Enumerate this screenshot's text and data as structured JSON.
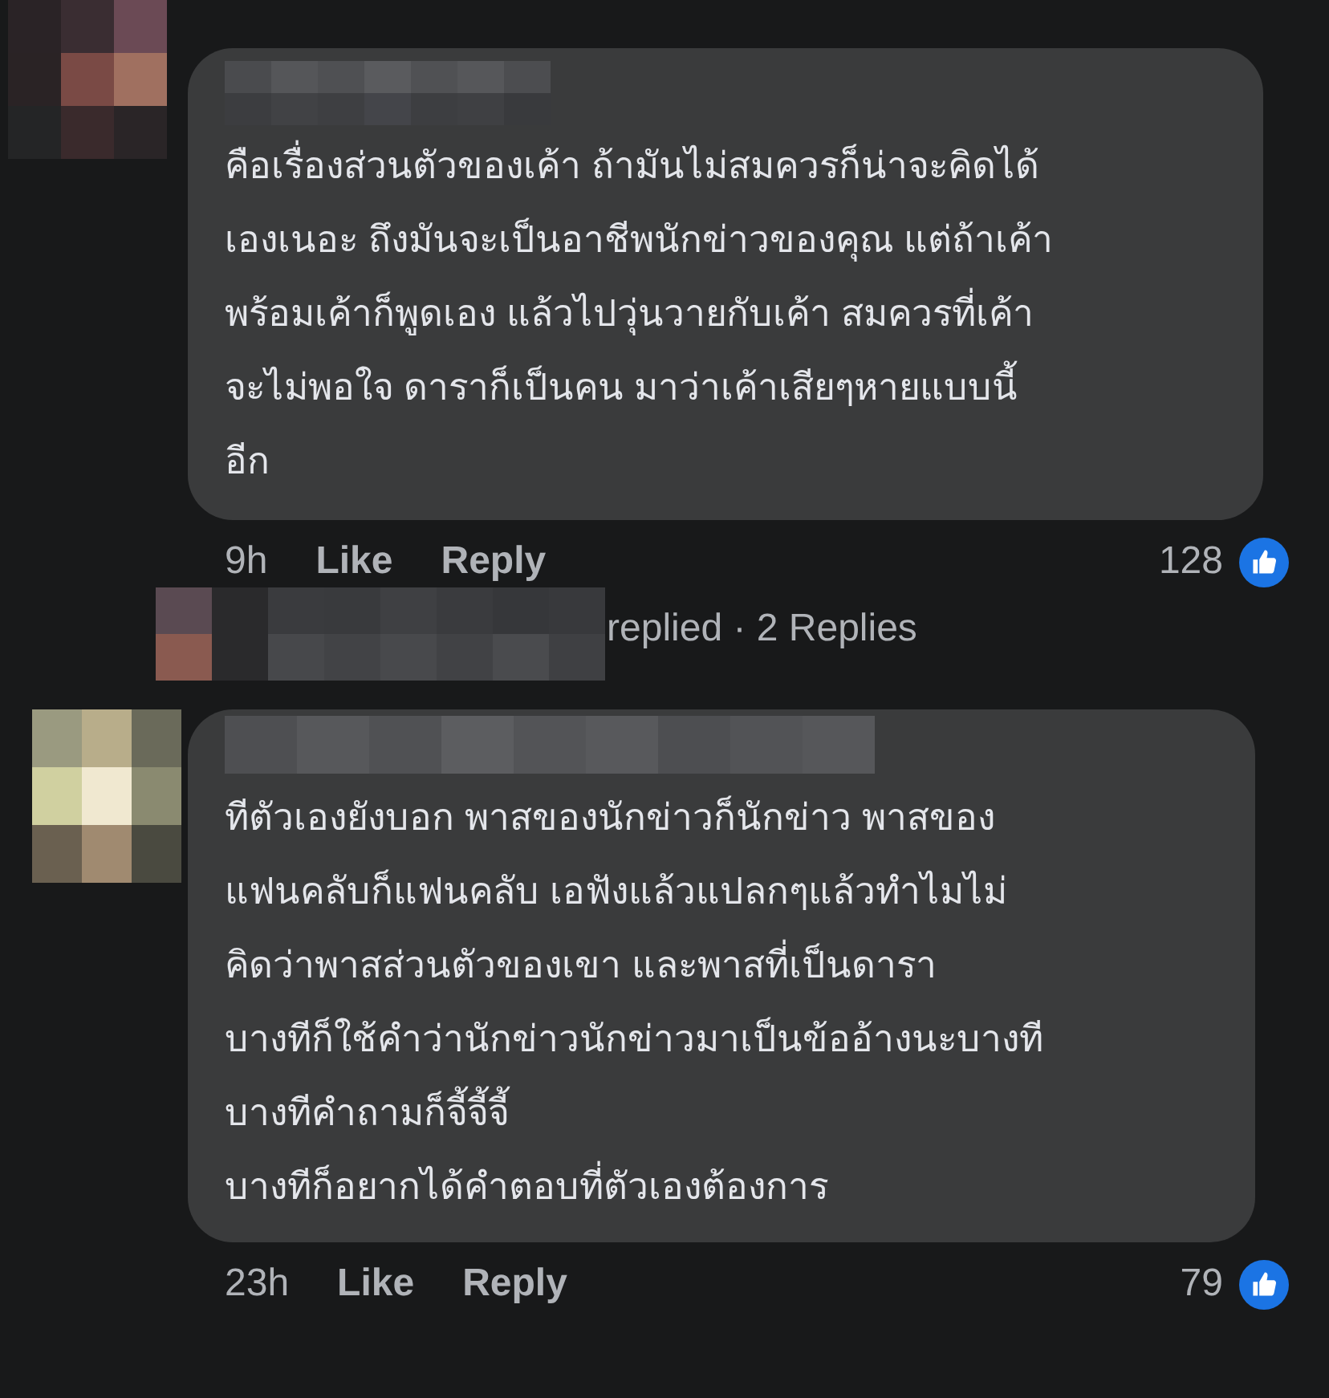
{
  "comments": [
    {
      "text": "คือเรื่องส่วนตัวของเค้า ถ้ามันไม่สมควรก็น่าจะคิดได้\nเองเนอะ ถึงมันจะเป็นอาชีพนักข่าวของคุณ แต่ถ้าเค้า\nพร้อมเค้าก็พูดเอง แล้วไปวุ่นวายกับเค้า สมควรที่เค้า\nจะไม่พอใจ ดาราก็เป็นคน มาว่าเค้าเสียๆหายแบบนี้\nอีก",
      "time": "9h",
      "actions": [
        "Like",
        "Reply"
      ],
      "reaction_count": "128",
      "replies": "replied · 2 Replies"
    },
    {
      "text": "ทีตัวเองยังบอก พาสของนักข่าวก็นักข่าว พาสของ\nแฟนคลับก็แฟนคลับ  เอฟังแล้วแปลกๆแล้วทำไมไม่\nคิดว่าพาสส่วนตัวของเขา และพาสที่เป็นดารา\nบางทีก็ใช้คำว่านักข่าวนักข่าวมาเป็นข้ออ้างนะบางที\nบางทีคำถามก็จี้จี้จี้\nบางทีก็อยากได้คำตอบที่ตัวเองต้องการ",
      "time": "23h",
      "actions": [
        "Like",
        "Reply"
      ],
      "reaction_count": "79"
    }
  ]
}
